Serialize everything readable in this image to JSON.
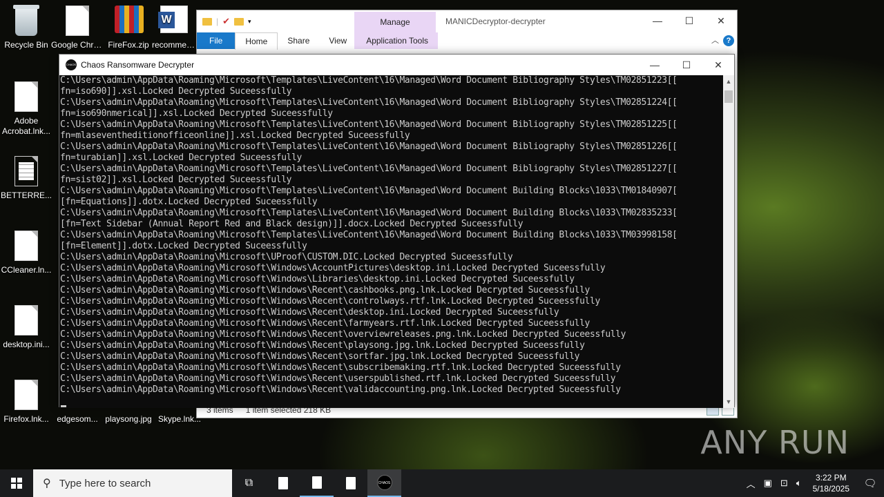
{
  "desktop_icons": [
    {
      "label": "Recycle Bin"
    },
    {
      "label": "Google Chrome"
    },
    {
      "label": "FireFox.zip"
    },
    {
      "label": "recommen..."
    },
    {
      "label": "Adobe Acrobat.lnk..."
    },
    {
      "label": "BETTERRE..."
    },
    {
      "label": "CCleaner.ln..."
    },
    {
      "label": "desktop.ini..."
    },
    {
      "label": "Firefox.lnk..."
    },
    {
      "label": "edgesom..."
    },
    {
      "label": "playsong.jpg"
    },
    {
      "label": "Skype.lnk..."
    }
  ],
  "explorer": {
    "manage": "Manage",
    "title": "MANICDecryptor-decrypter",
    "tabs": [
      "File",
      "Home",
      "Share",
      "View",
      "Application Tools"
    ],
    "help": "?",
    "status": {
      "items": "3 items",
      "selected": "1 item selected  218 KB"
    },
    "controls": {
      "min": "—",
      "max": "☐",
      "close": "✕"
    }
  },
  "chaos": {
    "logo": "CHAOS",
    "title": "Chaos Ransomware Decrypter",
    "controls": {
      "min": "—",
      "max": "☐",
      "close": "✕"
    },
    "lines": [
      "C:\\Users\\admin\\AppData\\Roaming\\Microsoft\\Templates\\LiveContent\\16\\Managed\\Word Document Bibliography Styles\\TM02851223[[",
      "fn=iso690]].xsl.Locked Decrypted Suceessfully",
      "C:\\Users\\admin\\AppData\\Roaming\\Microsoft\\Templates\\LiveContent\\16\\Managed\\Word Document Bibliography Styles\\TM02851224[[",
      "fn=iso690nmerical]].xsl.Locked Decrypted Suceessfully",
      "C:\\Users\\admin\\AppData\\Roaming\\Microsoft\\Templates\\LiveContent\\16\\Managed\\Word Document Bibliography Styles\\TM02851225[[",
      "fn=mlaseventheditionofficeonline]].xsl.Locked Decrypted Suceessfully",
      "C:\\Users\\admin\\AppData\\Roaming\\Microsoft\\Templates\\LiveContent\\16\\Managed\\Word Document Bibliography Styles\\TM02851226[[",
      "fn=turabian]].xsl.Locked Decrypted Suceessfully",
      "C:\\Users\\admin\\AppData\\Roaming\\Microsoft\\Templates\\LiveContent\\16\\Managed\\Word Document Bibliography Styles\\TM02851227[[",
      "fn=sist02]].xsl.Locked Decrypted Suceessfully",
      "C:\\Users\\admin\\AppData\\Roaming\\Microsoft\\Templates\\LiveContent\\16\\Managed\\Word Document Building Blocks\\1033\\TM01840907[",
      "[fn=Equations]].dotx.Locked Decrypted Suceessfully",
      "C:\\Users\\admin\\AppData\\Roaming\\Microsoft\\Templates\\LiveContent\\16\\Managed\\Word Document Building Blocks\\1033\\TM02835233[",
      "[fn=Text Sidebar (Annual Report Red and Black design)]].docx.Locked Decrypted Suceessfully",
      "C:\\Users\\admin\\AppData\\Roaming\\Microsoft\\Templates\\LiveContent\\16\\Managed\\Word Document Building Blocks\\1033\\TM03998158[",
      "[fn=Element]].dotx.Locked Decrypted Suceessfully",
      "C:\\Users\\admin\\AppData\\Roaming\\Microsoft\\UProof\\CUSTOM.DIC.Locked Decrypted Suceessfully",
      "C:\\Users\\admin\\AppData\\Roaming\\Microsoft\\Windows\\AccountPictures\\desktop.ini.Locked Decrypted Suceessfully",
      "C:\\Users\\admin\\AppData\\Roaming\\Microsoft\\Windows\\Libraries\\desktop.ini.Locked Decrypted Suceessfully",
      "C:\\Users\\admin\\AppData\\Roaming\\Microsoft\\Windows\\Recent\\cashbooks.png.lnk.Locked Decrypted Suceessfully",
      "C:\\Users\\admin\\AppData\\Roaming\\Microsoft\\Windows\\Recent\\controlways.rtf.lnk.Locked Decrypted Suceessfully",
      "C:\\Users\\admin\\AppData\\Roaming\\Microsoft\\Windows\\Recent\\desktop.ini.Locked Decrypted Suceessfully",
      "C:\\Users\\admin\\AppData\\Roaming\\Microsoft\\Windows\\Recent\\farmyears.rtf.lnk.Locked Decrypted Suceessfully",
      "C:\\Users\\admin\\AppData\\Roaming\\Microsoft\\Windows\\Recent\\overviewreleases.png.lnk.Locked Decrypted Suceessfully",
      "C:\\Users\\admin\\AppData\\Roaming\\Microsoft\\Windows\\Recent\\playsong.jpg.lnk.Locked Decrypted Suceessfully",
      "C:\\Users\\admin\\AppData\\Roaming\\Microsoft\\Windows\\Recent\\sortfar.jpg.lnk.Locked Decrypted Suceessfully",
      "C:\\Users\\admin\\AppData\\Roaming\\Microsoft\\Windows\\Recent\\subscribemaking.rtf.lnk.Locked Decrypted Suceessfully",
      "C:\\Users\\admin\\AppData\\Roaming\\Microsoft\\Windows\\Recent\\userspublished.rtf.lnk.Locked Decrypted Suceessfully",
      "C:\\Users\\admin\\AppData\\Roaming\\Microsoft\\Windows\\Recent\\validaccounting.png.lnk.Locked Decrypted Suceessfully"
    ]
  },
  "taskbar": {
    "search_placeholder": "Type here to search",
    "time": "3:22 PM",
    "date": "5/18/2025",
    "active_app": "CHAOS"
  },
  "watermark": "ANY RUN",
  "colors": {
    "console_bg": "#0c0c0c",
    "console_text": "#cccccc",
    "accent": "#1979ca",
    "manage_tab": "#e9d6f5"
  }
}
